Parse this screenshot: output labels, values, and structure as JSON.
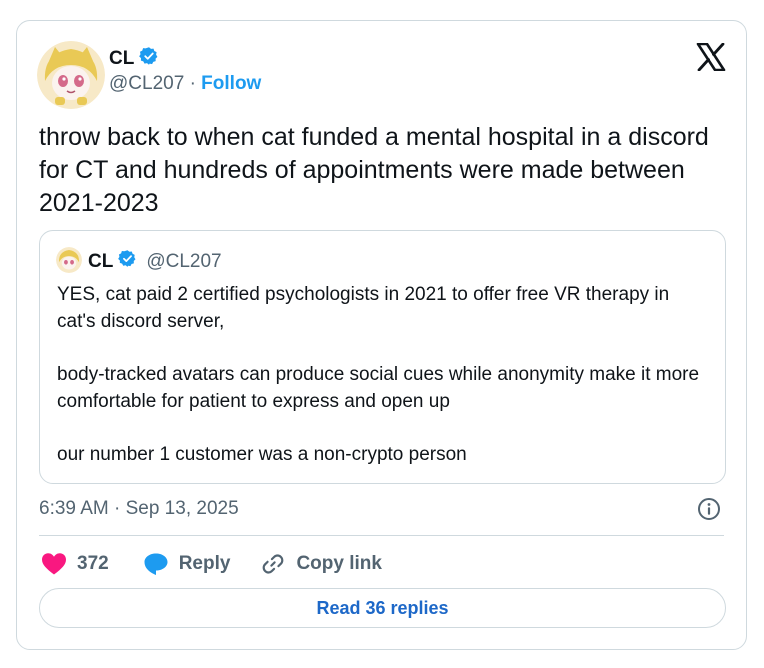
{
  "author": {
    "name": "CL",
    "handle": "@CL207",
    "separator": "·",
    "follow_label": "Follow",
    "verified": true
  },
  "tweet": {
    "text": "throw back to when cat funded a mental hospital in a discord for CT and hundreds of appointments were made between 2021-2023"
  },
  "quoted": {
    "name": "CL",
    "handle": "@CL207",
    "paragraphs": [
      "YES, cat paid 2 certified psychologists in 2021 to offer free VR therapy in cat's discord server,",
      "body-tracked avatars can produce social cues while anonymity make it more comfortable for patient to express and open up",
      "our number 1 customer was a non-crypto person"
    ]
  },
  "timestamp": "6:39 AM · Sep 13, 2025",
  "actions": {
    "like_count": "372",
    "reply_label": "Reply",
    "copy_label": "Copy link"
  },
  "read_replies_label": "Read 36 replies",
  "colors": {
    "accent": "#1d9bf0",
    "like": "#f91880",
    "muted": "#536471",
    "border": "#cfd9de"
  },
  "icons": [
    "verified-badge-icon",
    "x-logo-icon",
    "info-icon",
    "heart-icon",
    "reply-bubble-icon",
    "link-icon"
  ]
}
